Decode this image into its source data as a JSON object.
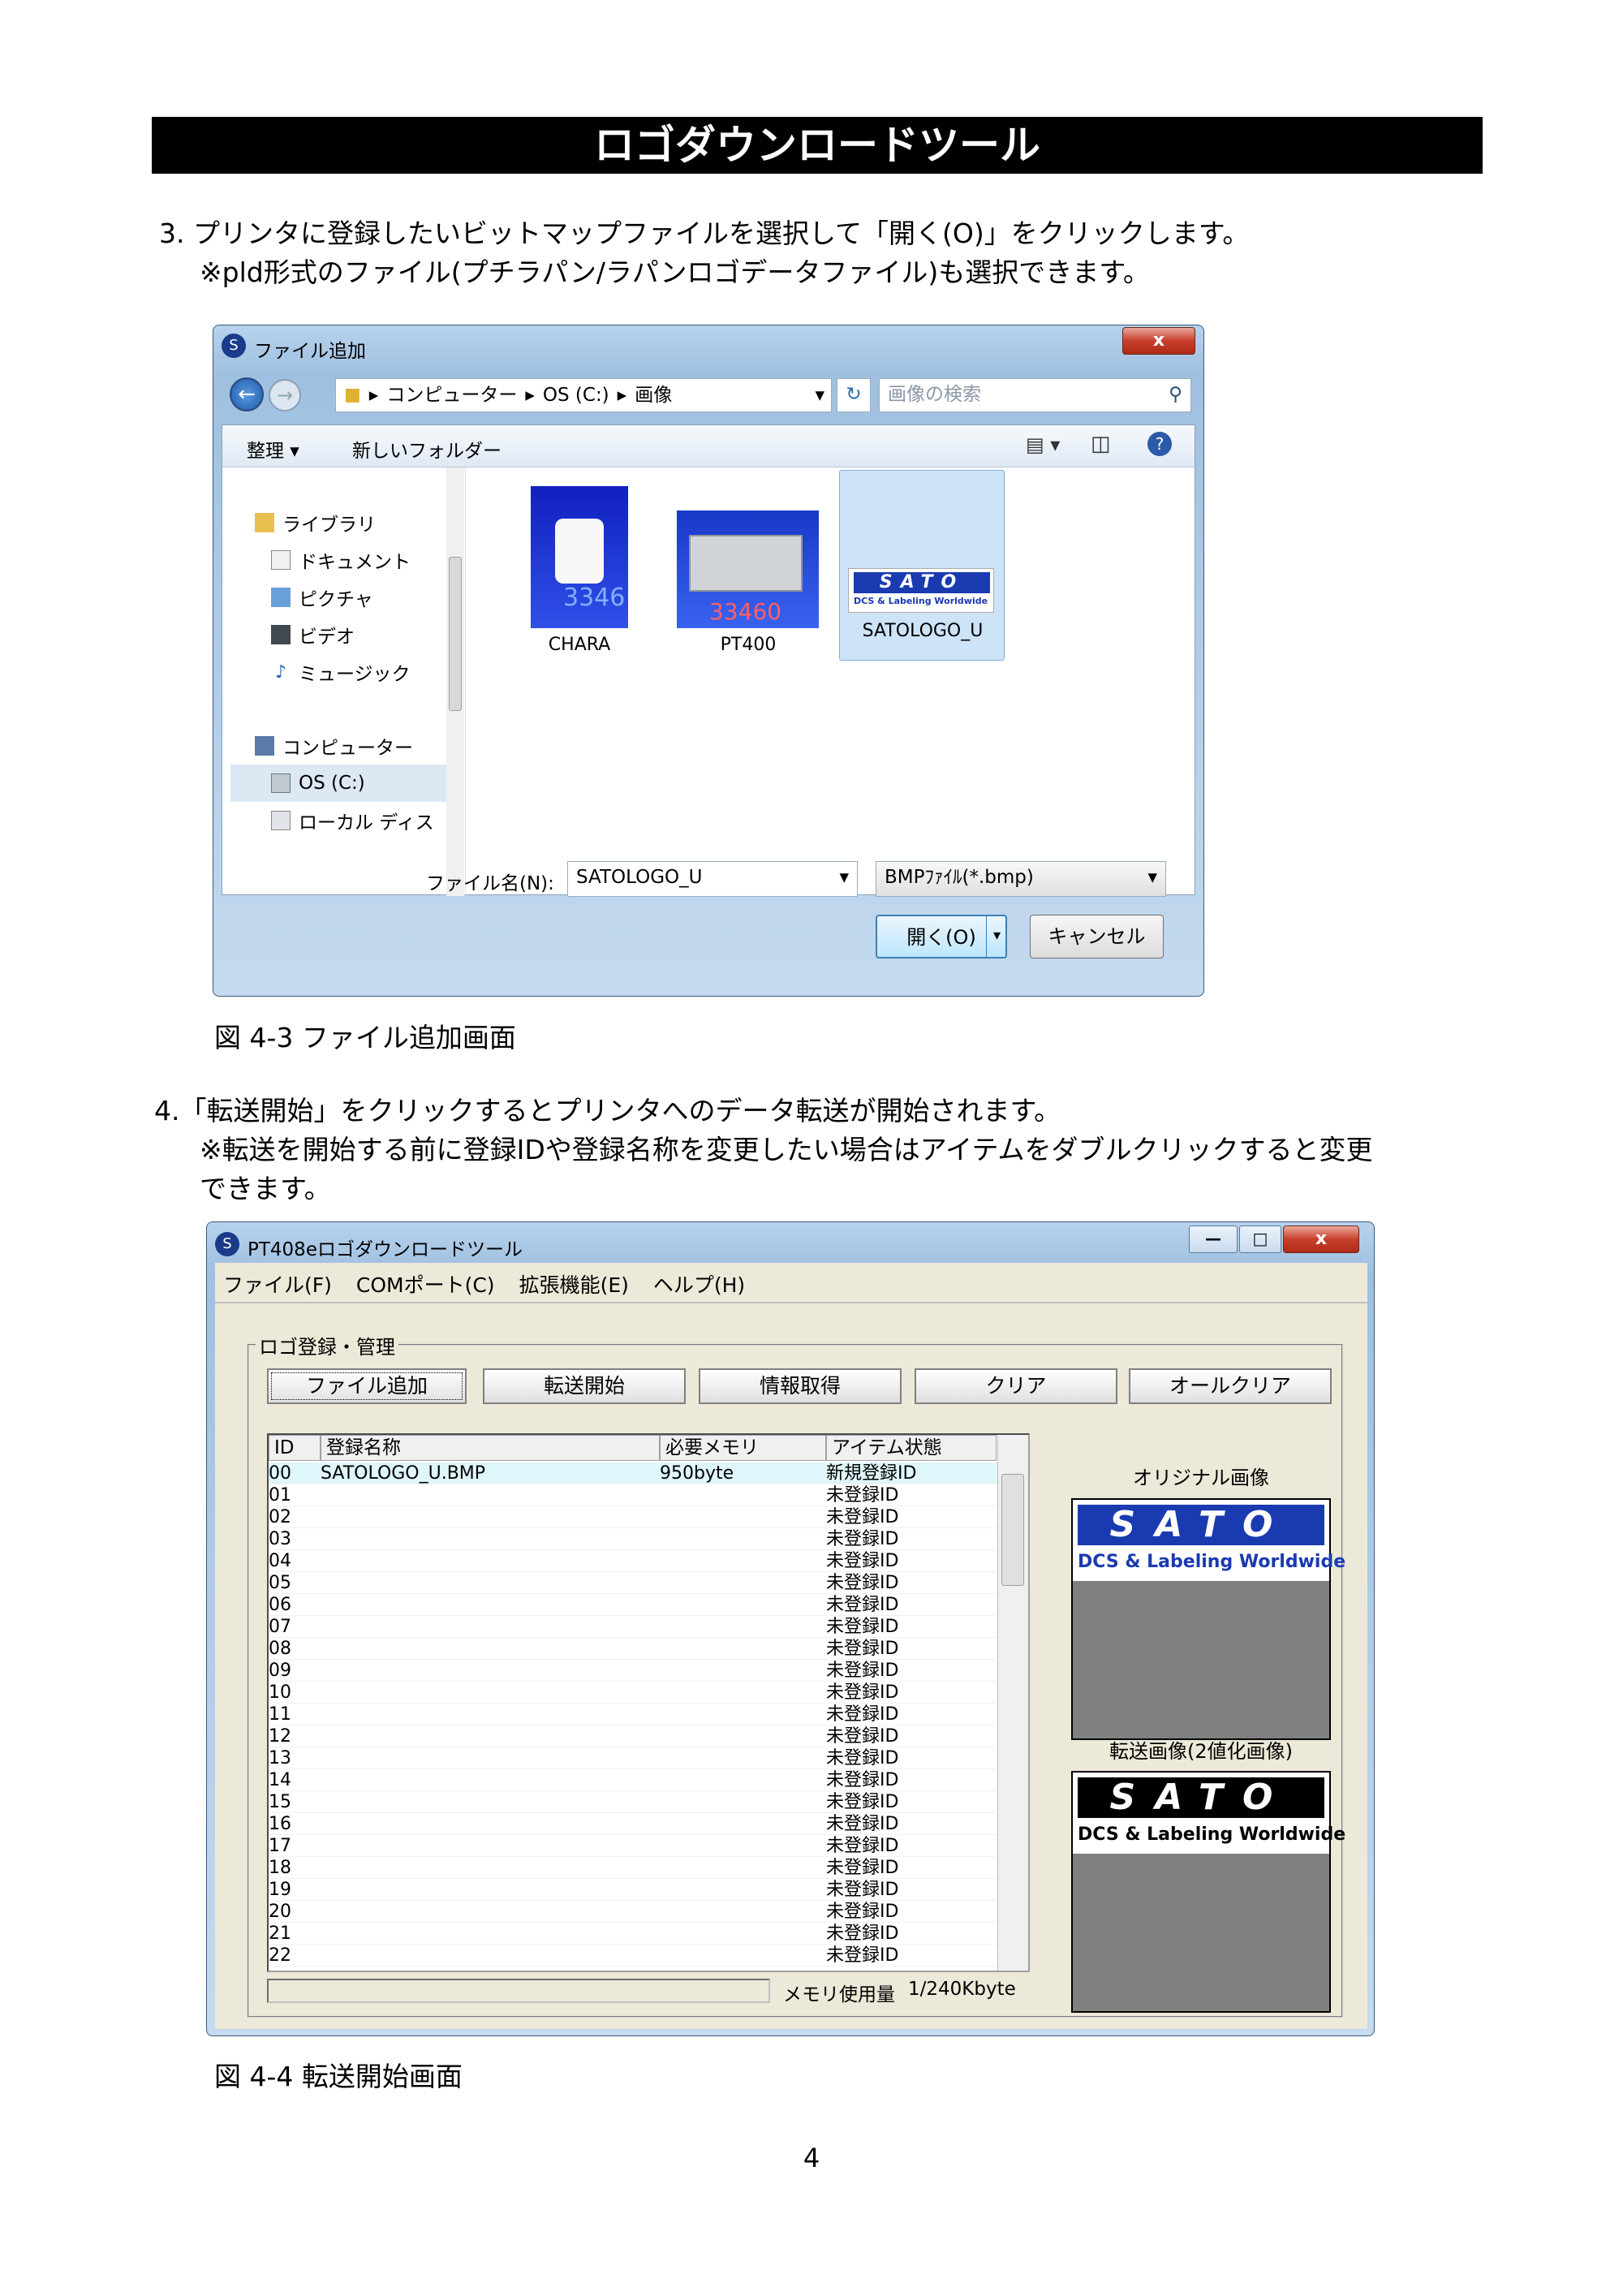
{
  "page": {
    "title": "ロゴダウンロードツール",
    "step3_line1": "3. プリンタに登録したいビットマップファイルを選択して「開く(O)」をクリックします。",
    "step3_line2": "※pld形式のファイル(プチラパン/ラパンロゴデータファイル)も選択できます。",
    "fig1_caption": "図 4-3 ファイル追加画面",
    "step4_line1": "4.「転送開始」をクリックするとプリンタへのデータ転送が開始されます。",
    "step4_line2": "※転送を開始する前に登録IDや登録名称を変更したい場合はアイテムをダブルクリックすると変更",
    "step4_line3": "できます。",
    "fig2_caption": "図 4-4 転送開始画面",
    "page_number": "4"
  },
  "dialog": {
    "title": "ファイル追加",
    "close": "x",
    "breadcrumb": [
      "コンピューター",
      "OS (C:)",
      "画像"
    ],
    "search_placeholder": "画像の検索",
    "organize": "整理 ▾",
    "new_folder": "新しいフォルダー",
    "sidebar": [
      "ライブラリ",
      "ドキュメント",
      "ピクチャ",
      "ビデオ",
      "ミュージック",
      "コンピューター",
      "OS (C:)",
      "ローカル ディス"
    ],
    "files": [
      "CHARA",
      "PT400",
      "SATOLOGO_U"
    ],
    "filename_label": "ファイル名(N):",
    "filename_value": "SATOLOGO_U",
    "filetype_value": "BMPﾌｧｲﾙ(*.bmp)",
    "open_button": "開く(O)",
    "cancel_button": "キャンセル"
  },
  "tool": {
    "title": "PT408eロゴダウンロードツール",
    "menu": [
      "ファイル(F)",
      "COMポート(C)",
      "拡張機能(E)",
      "ヘルプ(H)"
    ],
    "group_label": "ロゴ登録・管理",
    "buttons": [
      "ファイル追加",
      "転送開始",
      "情報取得",
      "クリア",
      "オールクリア"
    ],
    "columns": [
      "ID",
      "登録名称",
      "必要メモリ",
      "アイテム状態"
    ],
    "rows": [
      [
        "00",
        "SATOLOGO_U.BMP",
        "950byte",
        "新規登録ID"
      ],
      [
        "01",
        "",
        "",
        "未登録ID"
      ],
      [
        "02",
        "",
        "",
        "未登録ID"
      ],
      [
        "03",
        "",
        "",
        "未登録ID"
      ],
      [
        "04",
        "",
        "",
        "未登録ID"
      ],
      [
        "05",
        "",
        "",
        "未登録ID"
      ],
      [
        "06",
        "",
        "",
        "未登録ID"
      ],
      [
        "07",
        "",
        "",
        "未登録ID"
      ],
      [
        "08",
        "",
        "",
        "未登録ID"
      ],
      [
        "09",
        "",
        "",
        "未登録ID"
      ],
      [
        "10",
        "",
        "",
        "未登録ID"
      ],
      [
        "11",
        "",
        "",
        "未登録ID"
      ],
      [
        "12",
        "",
        "",
        "未登録ID"
      ],
      [
        "13",
        "",
        "",
        "未登録ID"
      ],
      [
        "14",
        "",
        "",
        "未登録ID"
      ],
      [
        "15",
        "",
        "",
        "未登録ID"
      ],
      [
        "16",
        "",
        "",
        "未登録ID"
      ],
      [
        "17",
        "",
        "",
        "未登録ID"
      ],
      [
        "18",
        "",
        "",
        "未登録ID"
      ],
      [
        "19",
        "",
        "",
        "未登録ID"
      ],
      [
        "20",
        "",
        "",
        "未登録ID"
      ],
      [
        "21",
        "",
        "",
        "未登録ID"
      ],
      [
        "22",
        "",
        "",
        "未登録ID"
      ]
    ],
    "original_label": "オリジナル画像",
    "transfer_label": "転送画像(2値化画像)",
    "logo_text": "SATO",
    "logo_sub": "DCS & Labeling Worldwide",
    "memory_label": "メモリ使用量",
    "memory_value": "1/240Kbyte"
  }
}
